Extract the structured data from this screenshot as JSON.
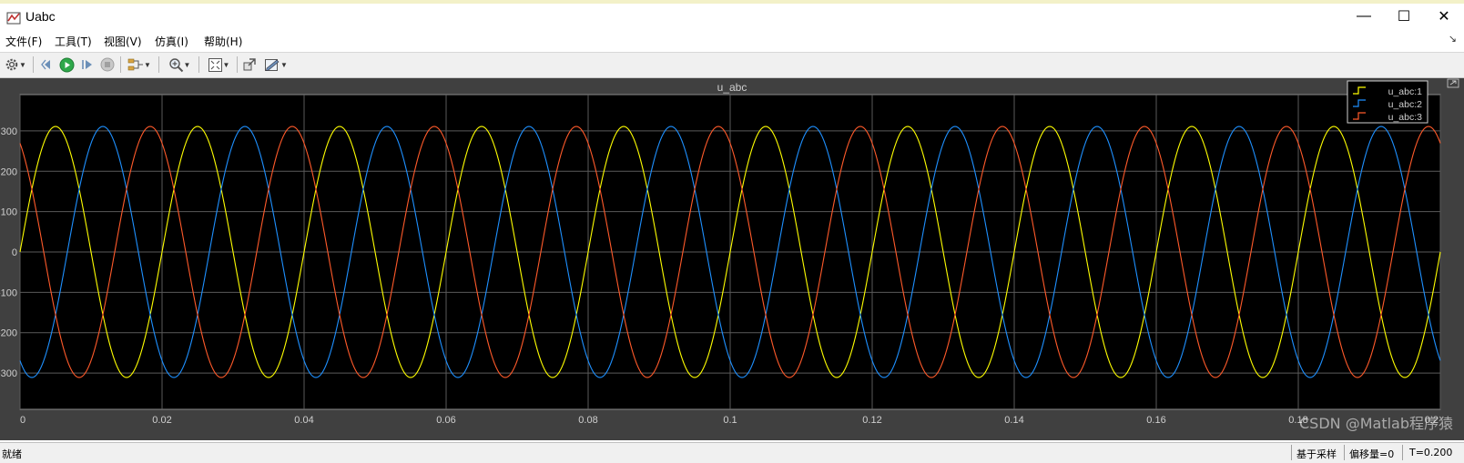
{
  "window": {
    "title": "Uabc",
    "minimize_glyph": "—",
    "maximize_glyph": "☐",
    "close_glyph": "✕"
  },
  "menu": {
    "items": [
      {
        "label": "文件(F)"
      },
      {
        "label": "工具(T)"
      },
      {
        "label": "视图(V)"
      },
      {
        "label": "仿真(I)"
      },
      {
        "label": "帮助(H)"
      }
    ],
    "corner_glyph": "↘"
  },
  "toolbar": {
    "items": [
      "settings-icon",
      "restore-history-icon",
      "run-icon",
      "step-forward-icon",
      "stop-icon",
      "signal-selector-icon",
      "zoom-icon",
      "fit-to-view-icon",
      "highlight-block-icon",
      "style-icon"
    ]
  },
  "status": {
    "ready": "就绪",
    "sampling": "基于采样",
    "offset": "偏移量=0",
    "time": "T=0.200"
  },
  "watermark": "CSDN @Matlab程序猿",
  "colors": {
    "phase1": "#ffff00",
    "phase2": "#1e90ff",
    "phase3": "#ff5a2a",
    "plot_bg": "#000000",
    "frame_bg": "#404040",
    "grid": "#5a5a5a",
    "text": "#cfcfcf"
  },
  "chart_data": {
    "type": "line",
    "title": "u_abc",
    "xlabel": "",
    "ylabel": "",
    "xlim": [
      0,
      0.2
    ],
    "ylim": [
      -390,
      390
    ],
    "x_ticks": [
      0,
      0.02,
      0.04,
      0.06,
      0.08,
      0.1,
      0.12,
      0.14,
      0.16,
      0.18,
      0.2
    ],
    "x_tick_labels": [
      "0",
      "0.02",
      "0.04",
      "0.06",
      "0.08",
      "0.1",
      "0.12",
      "0.14",
      "0.16",
      "0.18",
      "0.2"
    ],
    "y_ticks": [
      300,
      200,
      100,
      0,
      -100,
      -200,
      -300
    ],
    "y_tick_labels": [
      "300",
      "200",
      "100",
      "0",
      "-100",
      "-200",
      "-300"
    ],
    "grid": true,
    "legend_position": "top-right",
    "series": [
      {
        "name": "u_abc:1",
        "amplitude": 311,
        "frequency_hz": 50,
        "phase_deg": 0,
        "color": "#ffff00"
      },
      {
        "name": "u_abc:2",
        "amplitude": 311,
        "frequency_hz": 50,
        "phase_deg": -120,
        "color": "#1e90ff"
      },
      {
        "name": "u_abc:3",
        "amplitude": 311,
        "frequency_hz": 50,
        "phase_deg": 120,
        "color": "#ff5a2a"
      }
    ]
  }
}
